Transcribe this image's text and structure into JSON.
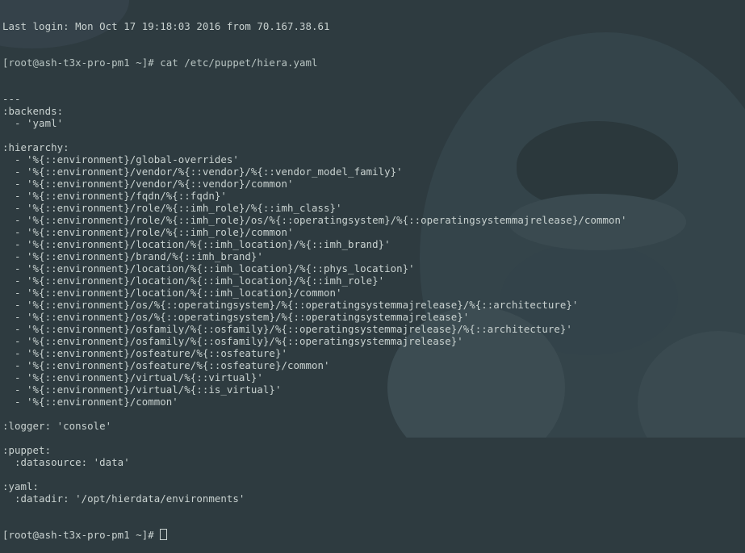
{
  "terminal": {
    "top_cutoff_text": "Last login: Mon Oct 17 19:18:03 2016 from 70.167.38.61",
    "command_prompt": "[root@ash-t3x-pro-pm1 ~]# cat /etc/puppet/hiera.yaml",
    "output_lines": [
      "---",
      ":backends:",
      "  - 'yaml'",
      "",
      ":hierarchy:",
      "  - '%{::environment}/global-overrides'",
      "  - '%{::environment}/vendor/%{::vendor}/%{::vendor_model_family}'",
      "  - '%{::environment}/vendor/%{::vendor}/common'",
      "  - '%{::environment}/fqdn/%{::fqdn}'",
      "  - '%{::environment}/role/%{::imh_role}/%{::imh_class}'",
      "  - '%{::environment}/role/%{::imh_role}/os/%{::operatingsystem}/%{::operatingsystemmajrelease}/common'",
      "  - '%{::environment}/role/%{::imh_role}/common'",
      "  - '%{::environment}/location/%{::imh_location}/%{::imh_brand}'",
      "  - '%{::environment}/brand/%{::imh_brand}'",
      "  - '%{::environment}/location/%{::imh_location}/%{::phys_location}'",
      "  - '%{::environment}/location/%{::imh_location}/%{::imh_role}'",
      "  - '%{::environment}/location/%{::imh_location}/common'",
      "  - '%{::environment}/os/%{::operatingsystem}/%{::operatingsystemmajrelease}/%{::architecture}'",
      "  - '%{::environment}/os/%{::operatingsystem}/%{::operatingsystemmajrelease}'",
      "  - '%{::environment}/osfamily/%{::osfamily}/%{::operatingsystemmajrelease}/%{::architecture}'",
      "  - '%{::environment}/osfamily/%{::osfamily}/%{::operatingsystemmajrelease}'",
      "  - '%{::environment}/osfeature/%{::osfeature}'",
      "  - '%{::environment}/osfeature/%{::osfeature}/common'",
      "  - '%{::environment}/virtual/%{::virtual}'",
      "  - '%{::environment}/virtual/%{::is_virtual}'",
      "  - '%{::environment}/common'",
      "",
      ":logger: 'console'",
      "",
      ":puppet:",
      "  :datasource: 'data'",
      "",
      ":yaml:",
      "  :datadir: '/opt/hierdata/environments'"
    ],
    "final_prompt": "[root@ash-t3x-pro-pm1 ~]# "
  },
  "colors": {
    "background": "#2e3b40",
    "text": "#c9d2d0"
  }
}
